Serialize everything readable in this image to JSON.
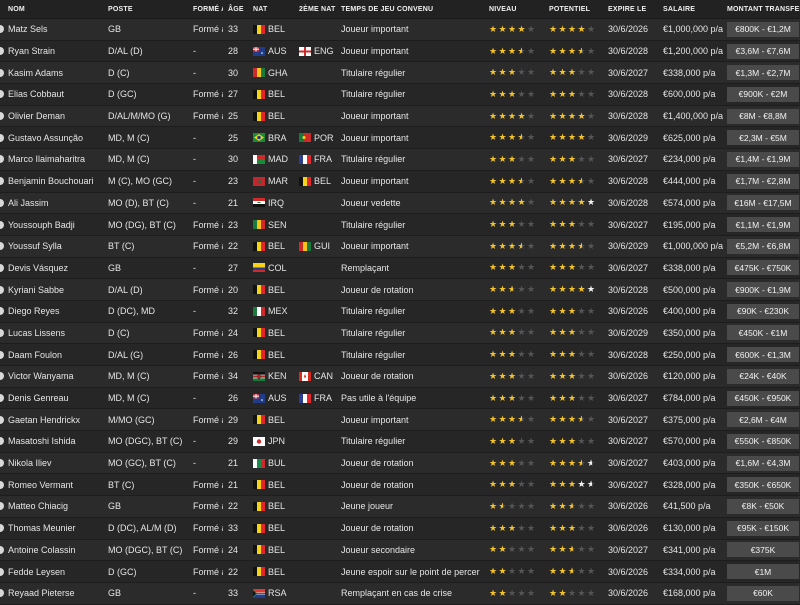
{
  "headers": {
    "name": "NOM",
    "position": "POSTE",
    "formed": "FORMÉ AU",
    "age": "ÂGE",
    "nat": "NAT",
    "nat2": "2ÈME NAT",
    "playtime": "TEMPS DE JEU CONVENU",
    "level": "NIVEAU",
    "potential": "POTENTIEL",
    "expires": "EXPIRE LE",
    "salary": "SALAIRE",
    "transfer": "MONTANT TRANSFERT"
  },
  "colors": {
    "star_filled": "#f2c32c",
    "star_empty": "#555555",
    "star_white": "#f4f4f4",
    "value_box": "#4a4a4a"
  },
  "players": [
    {
      "name": "Matz Sels",
      "position": "GB",
      "formed": "Formé au",
      "age": "33",
      "nat": "BEL",
      "nat_flag": [
        "#111",
        "#f5d415",
        "#e3262b"
      ],
      "nat2": "",
      "nat2_flag": null,
      "playtime": "Joueur important",
      "level": 4,
      "level_white": 0,
      "potential": 4,
      "potential_white": 0,
      "expires": "30/6/2026",
      "salary": "€1,000,000 p/a",
      "transfer": "€800K - €1,2M"
    },
    {
      "name": "Ryan Strain",
      "position": "D/AL (D)",
      "formed": "-",
      "age": "28",
      "nat": "AUS",
      "nat_flag": "aus",
      "nat2": "ENG",
      "nat2_flag": "eng",
      "playtime": "Joueur important",
      "level": 3.5,
      "level_white": 0,
      "potential": 3.5,
      "potential_white": 0,
      "expires": "30/6/2028",
      "salary": "€1,200,000 p/a",
      "transfer": "€3,6M - €7,6M"
    },
    {
      "name": "Kasim Adams",
      "position": "D (C)",
      "formed": "-",
      "age": "30",
      "nat": "GHA",
      "nat_flag": [
        "#cf2a2a",
        "#f6c515",
        "#1a7a3c"
      ],
      "nat2": "",
      "nat2_flag": null,
      "playtime": "Titulaire régulier",
      "level": 3,
      "level_white": 0,
      "potential": 3,
      "potential_white": 0,
      "expires": "30/6/2027",
      "salary": "€338,000 p/a",
      "transfer": "€1,3M - €2,7M"
    },
    {
      "name": "Elias Cobbaut",
      "position": "D (GC)",
      "formed": "Formé au",
      "age": "27",
      "nat": "BEL",
      "nat_flag": [
        "#111",
        "#f5d415",
        "#e3262b"
      ],
      "nat2": "",
      "nat2_flag": null,
      "playtime": "Titulaire régulier",
      "level": 3,
      "level_white": 0,
      "potential": 3,
      "potential_white": 0,
      "expires": "30/6/2028",
      "salary": "€600,000 p/a",
      "transfer": "€900K - €2M"
    },
    {
      "name": "Olivier Deman",
      "position": "D/AL/M/MO (G)",
      "formed": "Formé au",
      "age": "25",
      "nat": "BEL",
      "nat_flag": [
        "#111",
        "#f5d415",
        "#e3262b"
      ],
      "nat2": "",
      "nat2_flag": null,
      "playtime": "Joueur important",
      "level": 4,
      "level_white": 0,
      "potential": 4,
      "potential_white": 0,
      "expires": "30/6/2028",
      "salary": "€1,400,000 p/a",
      "transfer": "€8M - €8,8M"
    },
    {
      "name": "Gustavo Assunção",
      "position": "MD, M (C)",
      "formed": "-",
      "age": "25",
      "nat": "BRA",
      "nat_flag": "bra",
      "nat2": "POR",
      "nat2_flag": "por",
      "playtime": "Joueur important",
      "level": 3.5,
      "level_white": 0,
      "potential": 4,
      "potential_white": 0,
      "expires": "30/6/2029",
      "salary": "€625,000 p/a",
      "transfer": "€2,3M - €5M"
    },
    {
      "name": "Marco Ilaimaharitra",
      "position": "MD, M (C)",
      "formed": "-",
      "age": "30",
      "nat": "MAD",
      "nat_flag": "mad",
      "nat2": "FRA",
      "nat2_flag": [
        "#2a3f93",
        "#fff",
        "#e3262b"
      ],
      "playtime": "Titulaire régulier",
      "level": 3,
      "level_white": 0,
      "potential": 3,
      "potential_white": 0,
      "expires": "30/6/2027",
      "salary": "€234,000 p/a",
      "transfer": "€1,4M - €1,9M"
    },
    {
      "name": "Benjamin Bouchouari",
      "position": "M (C), MO (GC)",
      "formed": "-",
      "age": "23",
      "nat": "MAR",
      "nat_flag": "mar",
      "nat2": "BEL",
      "nat2_flag": [
        "#111",
        "#f5d415",
        "#e3262b"
      ],
      "playtime": "Joueur important",
      "level": 3.5,
      "level_white": 0,
      "potential": 3.5,
      "potential_white": 0,
      "expires": "30/6/2028",
      "salary": "€444,000 p/a",
      "transfer": "€1,7M - €2,8M"
    },
    {
      "name": "Ali Jassim",
      "position": "MO (D), BT (C)",
      "formed": "-",
      "age": "21",
      "nat": "IRQ",
      "nat_flag": "irq",
      "nat2": "",
      "nat2_flag": null,
      "playtime": "Joueur vedette",
      "level": 4,
      "level_white": 0,
      "potential": 4,
      "potential_white": 1,
      "expires": "30/6/2028",
      "salary": "€574,000 p/a",
      "transfer": "€16M - €17,5M"
    },
    {
      "name": "Youssouph Badji",
      "position": "MO (DG), BT (C)",
      "formed": "Formé au",
      "age": "23",
      "nat": "SEN",
      "nat_flag": [
        "#1a7a3c",
        "#f6c515",
        "#cf2a2a"
      ],
      "nat2": "",
      "nat2_flag": null,
      "playtime": "Titulaire régulier",
      "level": 3,
      "level_white": 0,
      "potential": 3,
      "potential_white": 0,
      "expires": "30/6/2027",
      "salary": "€195,000 p/a",
      "transfer": "€1,1M - €1,9M"
    },
    {
      "name": "Youssuf Sylla",
      "position": "BT (C)",
      "formed": "Formé au",
      "age": "22",
      "nat": "BEL",
      "nat_flag": [
        "#111",
        "#f5d415",
        "#e3262b"
      ],
      "nat2": "GUI",
      "nat2_flag": [
        "#cf2a2a",
        "#f6c515",
        "#1a7a3c"
      ],
      "playtime": "Joueur important",
      "level": 3.5,
      "level_white": 0,
      "potential": 3.5,
      "potential_white": 0,
      "expires": "30/6/2029",
      "salary": "€1,000,000 p/a",
      "transfer": "€5,2M - €6,8M"
    },
    {
      "name": "Devis Vásquez",
      "position": "GB",
      "formed": "-",
      "age": "27",
      "nat": "COL",
      "nat_flag": "col",
      "nat2": "",
      "nat2_flag": null,
      "playtime": "Remplaçant",
      "level": 3,
      "level_white": 0,
      "potential": 3,
      "potential_white": 0,
      "expires": "30/6/2027",
      "salary": "€338,000 p/a",
      "transfer": "€475K - €750K"
    },
    {
      "name": "Kyriani Sabbe",
      "position": "D/AL (D)",
      "formed": "Formé au",
      "age": "20",
      "nat": "BEL",
      "nat_flag": [
        "#111",
        "#f5d415",
        "#e3262b"
      ],
      "nat2": "",
      "nat2_flag": null,
      "playtime": "Joueur de rotation",
      "level": 2.5,
      "level_white": 0,
      "potential": 4,
      "potential_white": 1,
      "expires": "30/6/2028",
      "salary": "€500,000 p/a",
      "transfer": "€900K - €1,9M"
    },
    {
      "name": "Diego Reyes",
      "position": "D (DC), MD",
      "formed": "-",
      "age": "32",
      "nat": "MEX",
      "nat_flag": [
        "#1a7a3c",
        "#fff",
        "#cf2a2a"
      ],
      "nat2": "",
      "nat2_flag": null,
      "playtime": "Titulaire régulier",
      "level": 3,
      "level_white": 0,
      "potential": 3,
      "potential_white": 0,
      "expires": "30/6/2026",
      "salary": "€400,000 p/a",
      "transfer": "€90K - €230K"
    },
    {
      "name": "Lucas Lissens",
      "position": "D (C)",
      "formed": "Formé au",
      "age": "24",
      "nat": "BEL",
      "nat_flag": [
        "#111",
        "#f5d415",
        "#e3262b"
      ],
      "nat2": "",
      "nat2_flag": null,
      "playtime": "Titulaire régulier",
      "level": 3,
      "level_white": 0,
      "potential": 3,
      "potential_white": 0,
      "expires": "30/6/2029",
      "salary": "€350,000 p/a",
      "transfer": "€450K - €1M"
    },
    {
      "name": "Daam Foulon",
      "position": "D/AL (G)",
      "formed": "Formé au",
      "age": "26",
      "nat": "BEL",
      "nat_flag": [
        "#111",
        "#f5d415",
        "#e3262b"
      ],
      "nat2": "",
      "nat2_flag": null,
      "playtime": "Titulaire régulier",
      "level": 3,
      "level_white": 0,
      "potential": 3,
      "potential_white": 0,
      "expires": "30/6/2028",
      "salary": "€250,000 p/a",
      "transfer": "€600K - €1,3M"
    },
    {
      "name": "Victor Wanyama",
      "position": "MD, M (C)",
      "formed": "Formé au",
      "age": "34",
      "nat": "KEN",
      "nat_flag": "ken",
      "nat2": "CAN",
      "nat2_flag": "can",
      "playtime": "Joueur de rotation",
      "level": 3,
      "level_white": 0,
      "potential": 3,
      "potential_white": 0,
      "expires": "30/6/2026",
      "salary": "€120,000 p/a",
      "transfer": "€24K - €40K"
    },
    {
      "name": "Denis Genreau",
      "position": "MD, M (C)",
      "formed": "-",
      "age": "26",
      "nat": "AUS",
      "nat_flag": "aus",
      "nat2": "FRA",
      "nat2_flag": [
        "#2a3f93",
        "#fff",
        "#e3262b"
      ],
      "playtime": "Pas utile à l'équipe",
      "level": 3,
      "level_white": 0,
      "potential": 3,
      "potential_white": 0,
      "expires": "30/6/2027",
      "salary": "€784,000 p/a",
      "transfer": "€450K - €950K"
    },
    {
      "name": "Gaetan Hendrickx",
      "position": "M/MO (GC)",
      "formed": "Formé au",
      "age": "29",
      "nat": "BEL",
      "nat_flag": [
        "#111",
        "#f5d415",
        "#e3262b"
      ],
      "nat2": "",
      "nat2_flag": null,
      "playtime": "Joueur important",
      "level": 3.5,
      "level_white": 0,
      "potential": 3.5,
      "potential_white": 0,
      "expires": "30/6/2027",
      "salary": "€375,000 p/a",
      "transfer": "€2,6M - €4M"
    },
    {
      "name": "Masatoshi Ishida",
      "position": "MO (DGC), BT (C)",
      "formed": "-",
      "age": "29",
      "nat": "JPN",
      "nat_flag": "jpn",
      "nat2": "",
      "nat2_flag": null,
      "playtime": "Titulaire régulier",
      "level": 3,
      "level_white": 0,
      "potential": 3,
      "potential_white": 0,
      "expires": "30/6/2027",
      "salary": "€570,000 p/a",
      "transfer": "€550K - €850K"
    },
    {
      "name": "Nikola Iliev",
      "position": "MO (GC), BT (C)",
      "formed": "-",
      "age": "21",
      "nat": "BUL",
      "nat_flag": [
        "#fff",
        "#1a8a4c",
        "#cf2a2a"
      ],
      "nat2": "",
      "nat2_flag": null,
      "playtime": "Joueur de rotation",
      "level": 3,
      "level_white": 0,
      "potential": 3.5,
      "potential_white": 1,
      "expires": "30/6/2027",
      "salary": "€403,000 p/a",
      "transfer": "€1,6M - €4,3M"
    },
    {
      "name": "Romeo Vermant",
      "position": "BT (C)",
      "formed": "Formé au",
      "age": "21",
      "nat": "BEL",
      "nat_flag": [
        "#111",
        "#f5d415",
        "#e3262b"
      ],
      "nat2": "",
      "nat2_flag": null,
      "playtime": "Joueur de rotation",
      "level": 3,
      "level_white": 0,
      "potential": 3,
      "potential_white": 1.5,
      "expires": "30/6/2027",
      "salary": "€328,000 p/a",
      "transfer": "€350K - €650K"
    },
    {
      "name": "Matteo Chiacig",
      "position": "GB",
      "formed": "Formé au",
      "age": "22",
      "nat": "BEL",
      "nat_flag": [
        "#111",
        "#f5d415",
        "#e3262b"
      ],
      "nat2": "",
      "nat2_flag": null,
      "playtime": "Jeune joueur",
      "level": 1.5,
      "level_white": 0,
      "potential": 2.5,
      "potential_white": 0,
      "expires": "30/6/2026",
      "salary": "€41,500 p/a",
      "transfer": "€8K - €50K"
    },
    {
      "name": "Thomas Meunier",
      "position": "D (DC), AL/M (D)",
      "formed": "Formé au",
      "age": "33",
      "nat": "BEL",
      "nat_flag": [
        "#111",
        "#f5d415",
        "#e3262b"
      ],
      "nat2": "",
      "nat2_flag": null,
      "playtime": "Joueur de rotation",
      "level": 3,
      "level_white": 0,
      "potential": 3,
      "potential_white": 0,
      "expires": "30/6/2026",
      "salary": "€130,000 p/a",
      "transfer": "€95K - €150K"
    },
    {
      "name": "Antoine Colassin",
      "position": "MO (DGC), BT (C)",
      "formed": "Formé au",
      "age": "24",
      "nat": "BEL",
      "nat_flag": [
        "#111",
        "#f5d415",
        "#e3262b"
      ],
      "nat2": "",
      "nat2_flag": null,
      "playtime": "Joueur secondaire",
      "level": 2,
      "level_white": 0,
      "potential": 2.5,
      "potential_white": 0,
      "expires": "30/6/2027",
      "salary": "€341,000 p/a",
      "transfer": "€375K"
    },
    {
      "name": "Fedde Leysen",
      "position": "D (GC)",
      "formed": "Formé au",
      "age": "22",
      "nat": "BEL",
      "nat_flag": [
        "#111",
        "#f5d415",
        "#e3262b"
      ],
      "nat2": "",
      "nat2_flag": null,
      "playtime": "Jeune espoir sur le point de percer",
      "level": 2,
      "level_white": 0,
      "potential": 2.5,
      "potential_white": 0,
      "expires": "30/6/2026",
      "salary": "€334,000 p/a",
      "transfer": "€1M"
    },
    {
      "name": "Reyaad Pieterse",
      "position": "GB",
      "formed": "-",
      "age": "33",
      "nat": "RSA",
      "nat_flag": "rsa",
      "nat2": "",
      "nat2_flag": null,
      "playtime": "Remplaçant en cas de crise",
      "level": 2,
      "level_white": 0,
      "potential": 2,
      "potential_white": 0,
      "expires": "30/6/2026",
      "salary": "€168,000 p/a",
      "transfer": "€60K"
    }
  ]
}
